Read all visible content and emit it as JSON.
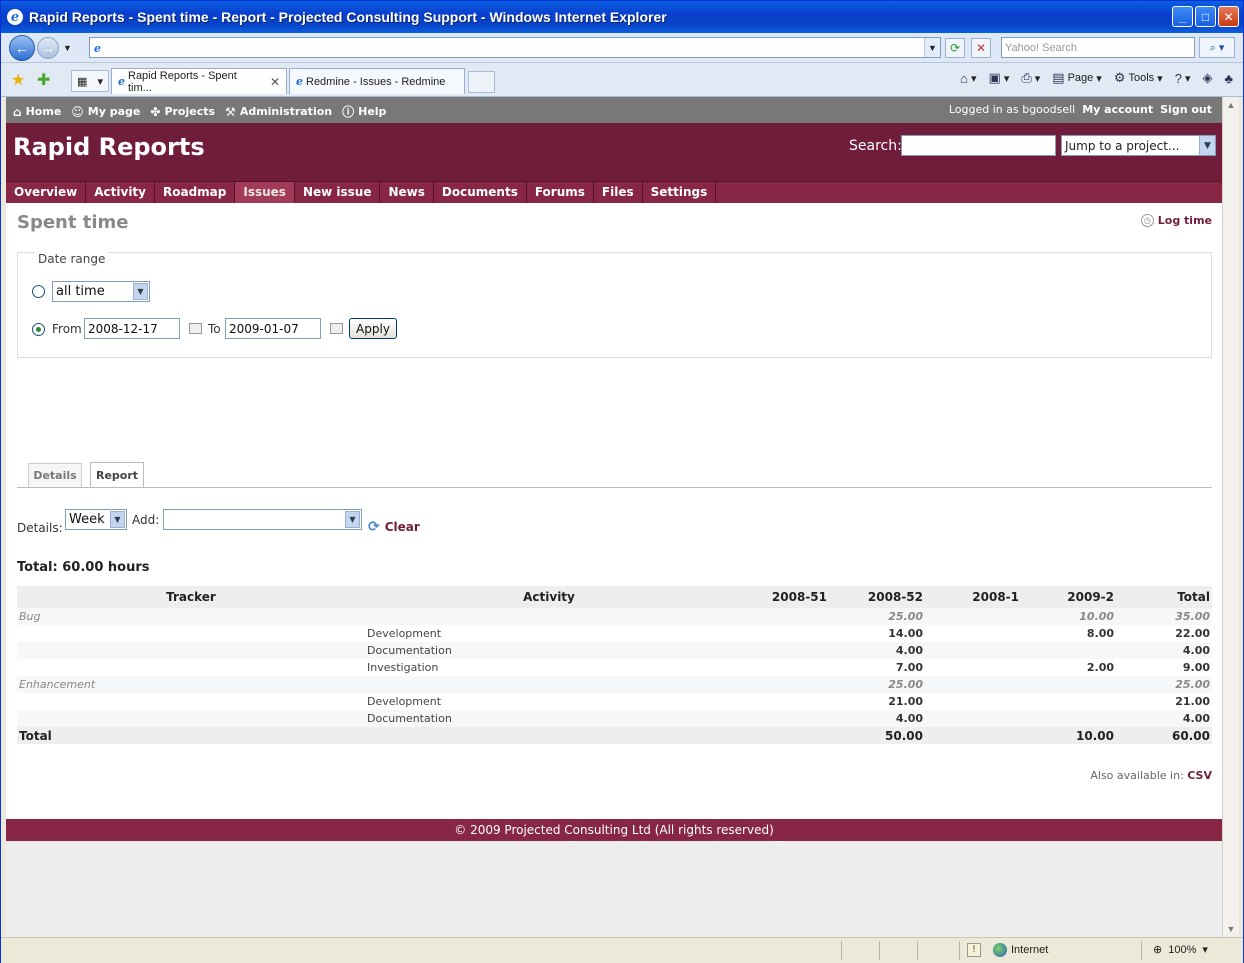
{
  "browser": {
    "window_title": "Rapid Reports - Spent time - Report - Projected Consulting Support - Windows Internet Explorer",
    "search_placeholder": "Yahoo! Search",
    "tabs": [
      {
        "label": "Rapid Reports - Spent tim..."
      },
      {
        "label": "Redmine - Issues - Redmine"
      }
    ],
    "commands": {
      "page": "Page",
      "tools": "Tools"
    },
    "status": {
      "zone": "Internet",
      "zoom": "100%"
    }
  },
  "top_menu": {
    "items": [
      "Home",
      "My page",
      "Projects",
      "Administration",
      "Help"
    ],
    "logged_as": "Logged in as bgoodsell",
    "my_account": "My account",
    "sign_out": "Sign out"
  },
  "header": {
    "title": "Rapid Reports",
    "search_label": "Search:",
    "jump_label": "Jump to a project..."
  },
  "main_menu": [
    "Overview",
    "Activity",
    "Roadmap",
    "Issues",
    "New issue",
    "News",
    "Documents",
    "Forums",
    "Files",
    "Settings"
  ],
  "page": {
    "title": "Spent time",
    "log_time": "Log time",
    "date_range_legend": "Date range",
    "period_value": "all time",
    "from_label": "From",
    "from_value": "2008-12-17",
    "to_label": "To",
    "to_value": "2009-01-07",
    "apply_label": "Apply",
    "tabs": [
      "Details",
      "Report"
    ],
    "details_label": "Details:",
    "details_value": "Week",
    "add_label": "Add:",
    "clear_label": "Clear",
    "total_text": "Total: 60.00 hours",
    "also_label": "Also available in:",
    "csv_label": "CSV"
  },
  "report": {
    "headers": [
      "Tracker",
      "Activity",
      "2008-51",
      "2008-52",
      "2008-1",
      "2009-2",
      "Total"
    ],
    "rows": [
      {
        "kind": "subtotal",
        "tracker": "Bug",
        "activity": "",
        "c1": "",
        "c2": "25.00",
        "c3": "",
        "c4": "10.00",
        "total": "35.00"
      },
      {
        "kind": "detail",
        "tracker": "",
        "activity": "Development",
        "c1": "",
        "c2": "14.00",
        "c3": "",
        "c4": "8.00",
        "total": "22.00"
      },
      {
        "kind": "detail",
        "tracker": "",
        "activity": "Documentation",
        "c1": "",
        "c2": "4.00",
        "c3": "",
        "c4": "",
        "total": "4.00"
      },
      {
        "kind": "detail",
        "tracker": "",
        "activity": "Investigation",
        "c1": "",
        "c2": "7.00",
        "c3": "",
        "c4": "2.00",
        "total": "9.00"
      },
      {
        "kind": "subtotal",
        "tracker": "Enhancement",
        "activity": "",
        "c1": "",
        "c2": "25.00",
        "c3": "",
        "c4": "",
        "total": "25.00"
      },
      {
        "kind": "detail",
        "tracker": "",
        "activity": "Development",
        "c1": "",
        "c2": "21.00",
        "c3": "",
        "c4": "",
        "total": "21.00"
      },
      {
        "kind": "detail",
        "tracker": "",
        "activity": "Documentation",
        "c1": "",
        "c2": "4.00",
        "c3": "",
        "c4": "",
        "total": "4.00"
      }
    ],
    "total_row": {
      "label": "Total",
      "c1": "",
      "c2": "50.00",
      "c3": "",
      "c4": "10.00",
      "total": "60.00"
    }
  },
  "footer": {
    "text": "© 2009 Projected Consulting Ltd (All rights reserved)"
  },
  "colors": {
    "brand": "#701d3c",
    "menu": "#882745",
    "top_menu": "#787878"
  }
}
